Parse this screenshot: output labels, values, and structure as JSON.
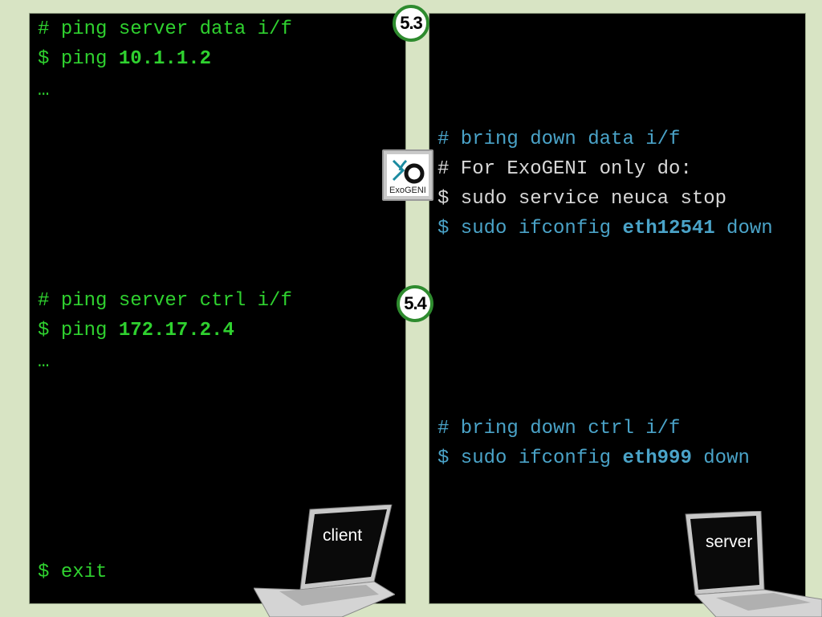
{
  "client": {
    "lines": [
      {
        "prefix": "# ",
        "text": "ping server data i/f",
        "bold": ""
      },
      {
        "prefix": "$ ",
        "text": "ping ",
        "bold": "10.1.1.2"
      },
      {
        "prefix": "",
        "text": "…",
        "bold": ""
      },
      {
        "prefix": "# ",
        "text": "ping server ctrl i/f",
        "bold": ""
      },
      {
        "prefix": "$ ",
        "text": "ping ",
        "bold": "172.17.2.4"
      },
      {
        "prefix": "",
        "text": "…",
        "bold": ""
      },
      {
        "prefix": "$ ",
        "text": "exit",
        "bold": ""
      }
    ],
    "label": "client"
  },
  "server": {
    "data_block": {
      "comment1": "# bring down data i/f",
      "comment2": "# For ExoGENI only do:",
      "cmd1": "$ sudo service neuca stop",
      "cmd2_prefix": "$ sudo ifconfig ",
      "cmd2_bold": "eth12541",
      "cmd2_suffix": " down"
    },
    "ctrl_block": {
      "comment": "# bring down ctrl i/f",
      "cmd_prefix": "$ sudo ifconfig ",
      "cmd_bold": "eth999",
      "cmd_suffix": " down"
    },
    "label": "server"
  },
  "badges": {
    "step1": "5.3",
    "step2": "5.4"
  },
  "logo": {
    "name": "ExoGENI",
    "icon": "exogeni-logo"
  },
  "colors": {
    "green_text": "#2fd12f",
    "blue_text": "#4aa3c8",
    "white_text": "#d8d8d8",
    "badge_border": "#2e8b2e",
    "background": "#d8e4c4"
  }
}
